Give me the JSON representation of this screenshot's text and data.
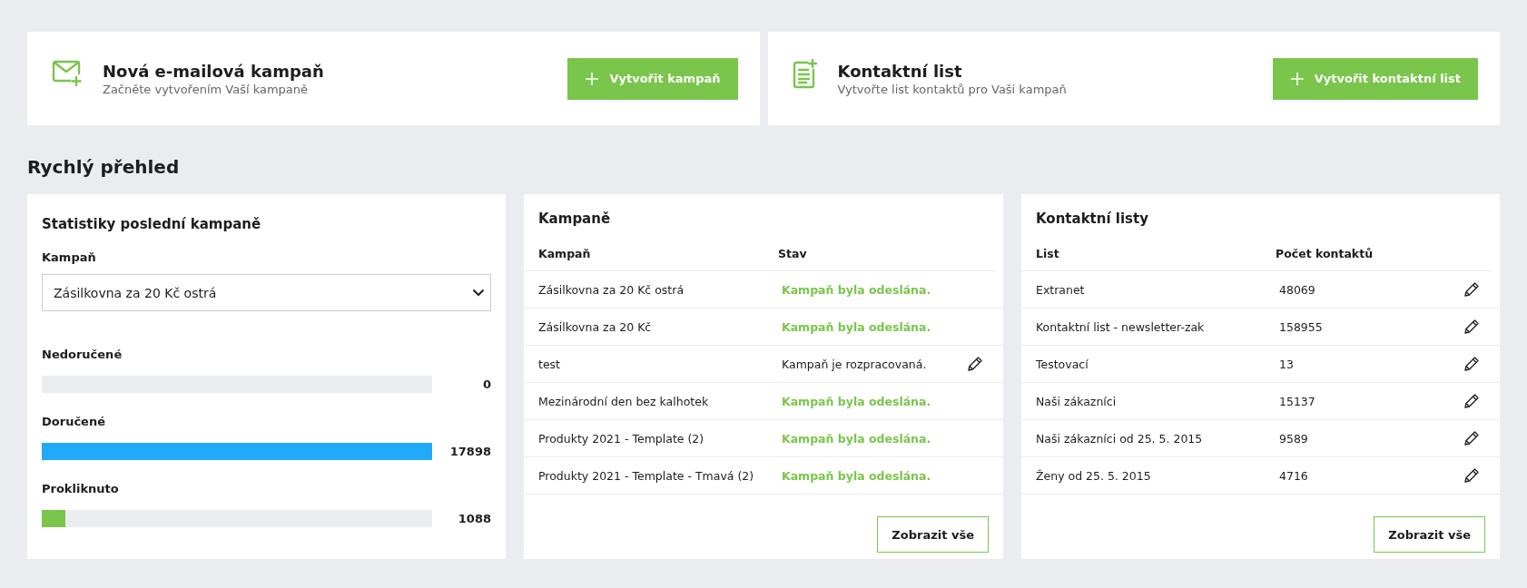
{
  "actions": [
    {
      "kind": "mail",
      "title": "Nová e-mailová kampaň",
      "subtitle": "Začněte vytvořením Vaší kampaně",
      "button": "Vytvořit kampaň"
    },
    {
      "kind": "list",
      "title": "Kontaktní list",
      "subtitle": "Vytvořte list kontaktů pro Vaši kampaň",
      "button": "Vytvořit kontaktní list"
    }
  ],
  "overview_title": "Rychlý přehled",
  "stats": {
    "title": "Statistiky poslední kampaně",
    "select_label": "Kampaň",
    "select_value": "Zásilkovna za 20 Kč ostrá",
    "bars": [
      {
        "label": "Nedoručené",
        "level": 0,
        "value": "0"
      },
      {
        "label": "Doručené",
        "level": 1,
        "value": "17898",
        "color": "#22aaf8"
      },
      {
        "label": "Prokliknuto",
        "level": 0.06,
        "value": "1088",
        "color": "#7ac54b"
      }
    ]
  },
  "campaigns": {
    "title": "Kampaně",
    "columns": [
      "Kampaň",
      "Stav"
    ],
    "rows": [
      {
        "name": "Zásilkovna za 20 Kč ostrá",
        "status": "Kampaň byla odeslána.",
        "kind": "sent"
      },
      {
        "name": "Zásilkovna za 20 Kč",
        "status": "Kampaň byla odeslána.",
        "kind": "sent"
      },
      {
        "name": "test",
        "status": "Kampaň je rozpracovaná.",
        "kind": "draft"
      },
      {
        "name": "Mezinárodní den bez kalhotek",
        "status": "Kampaň byla odeslána.",
        "kind": "sent"
      },
      {
        "name": "Produkty 2021 - Template (2)",
        "status": "Kampaň byla odeslána.",
        "kind": "sent"
      },
      {
        "name": "Produkty 2021 - Template - Tmavá (2)",
        "status": "Kampaň byla odeslána.",
        "kind": "sent"
      }
    ],
    "button": "Zobrazit vše"
  },
  "contact_lists": {
    "title": "Kontaktní listy",
    "columns": [
      "List",
      "Počet kontaktů"
    ],
    "rows": [
      {
        "name": "Extranet",
        "count": "48069"
      },
      {
        "name": "Kontaktní list - newsletter-zak",
        "count": "158955"
      },
      {
        "name": "Testovací",
        "count": "13"
      },
      {
        "name": "Naši zákazníci",
        "count": "15137"
      },
      {
        "name": "Naši zákazníci od 25. 5. 2015",
        "count": "9589"
      },
      {
        "name": "Ženy od 25. 5. 2015",
        "count": "4716"
      }
    ],
    "button": "Zobrazit vše"
  }
}
